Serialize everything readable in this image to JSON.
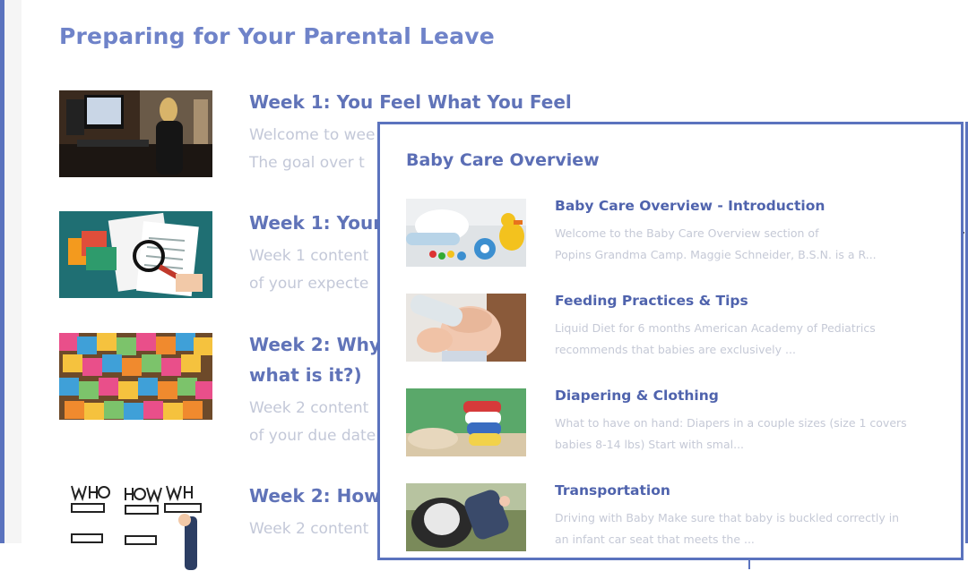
{
  "back_panel": {
    "title": "Preparing for Your Parental Leave",
    "items": [
      {
        "title": "Week 1: You Feel What You Feel",
        "title2": "",
        "line1": "Welcome to wee",
        "line2": " The goal over t",
        "image": "woman-at-desk-photo"
      },
      {
        "title": "Week 1: Your",
        "title2": "",
        "line1": "Week 1 content",
        "line2": "of your expecte",
        "image": "documents-magnifier-illustration"
      },
      {
        "title": "Week 2: Why",
        "title2": "what is it?)",
        "line1": "Week 2 content",
        "line2": "of your due date",
        "image": "sticky-notes-photo"
      },
      {
        "title": "Week 2: How",
        "title2": "",
        "line1": "Week 2 content",
        "line2": "",
        "image": "who-how-what-sketch"
      }
    ]
  },
  "front_panel": {
    "title": "Baby Care Overview",
    "items": [
      {
        "title": "Baby Care Overview - Introduction",
        "line1": "Welcome to the Baby Care Overview section of",
        "line2": "Popins Grandma Camp. Maggie Schneider, B.S.N. is a R...",
        "image": "baby-items-photo"
      },
      {
        "title": "Feeding Practices & Tips",
        "line1": "Liquid Diet for 6 months American Academy of Pediatrics",
        "line2": "recommends that babies are exclusively ...",
        "image": "baby-bottle-photo"
      },
      {
        "title": "Diapering & Clothing",
        "line1": "What to have on hand: Diapers in a couple sizes (size 1 covers",
        "line2": "babies 8-14 lbs) Start with smal...",
        "image": "cloth-diapers-photo"
      },
      {
        "title": "Transportation",
        "line1": "Driving with Baby Make sure that baby is buckled correctly in",
        "line2": "an infant car seat that meets the ...",
        "image": "car-seat-photo"
      }
    ]
  },
  "colors": {
    "accent": "#5b73be",
    "heading": "#6f83c9",
    "muted_text": "#c3c8d8"
  }
}
